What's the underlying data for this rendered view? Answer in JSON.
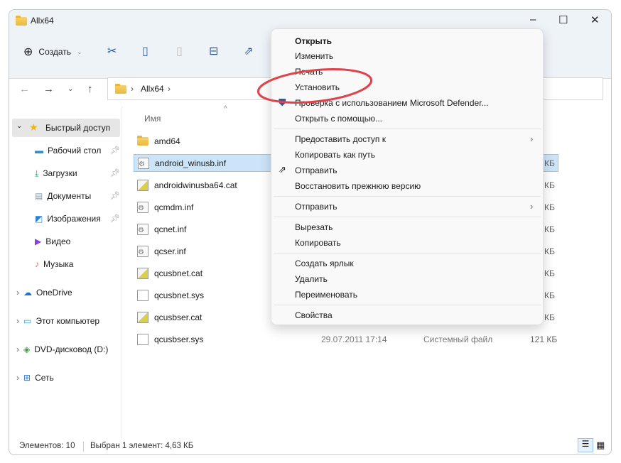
{
  "window": {
    "title": "Allx64"
  },
  "toolbar": {
    "create_label": "Создать"
  },
  "address": {
    "path": "Allx64"
  },
  "columns": {
    "name": "Имя"
  },
  "sidebar": {
    "quick_access": "Быстрый доступ",
    "items": [
      {
        "label": "Рабочий стол"
      },
      {
        "label": "Загрузки"
      },
      {
        "label": "Документы"
      },
      {
        "label": "Изображения"
      },
      {
        "label": "Видео"
      },
      {
        "label": "Музыка"
      }
    ],
    "roots": [
      {
        "label": "OneDrive"
      },
      {
        "label": "Этот компьютер"
      },
      {
        "label": "DVD-дисковод (D:)"
      },
      {
        "label": "Сеть"
      }
    ]
  },
  "files": [
    {
      "name": "amd64",
      "size": ""
    },
    {
      "name": "android_winusb.inf",
      "size": "КБ"
    },
    {
      "name": "androidwinusba64.cat",
      "size": "КБ"
    },
    {
      "name": "qcmdm.inf",
      "size": "КБ"
    },
    {
      "name": "qcnet.inf",
      "size": "КБ"
    },
    {
      "name": "qcser.inf",
      "size": "КБ"
    },
    {
      "name": "qcusbnet.cat",
      "size": "КБ"
    },
    {
      "name": "qcusbnet.sys",
      "size": "КБ"
    },
    {
      "name": "qcusbser.cat",
      "size": "КБ"
    },
    {
      "name": "qcusbser.sys",
      "date": "29.07.2011 17:14",
      "type": "Системный файл",
      "size": "121 КБ"
    }
  ],
  "menu": {
    "items": [
      "Открыть",
      "Изменить",
      "Печать",
      "Установить",
      "Проверка с использованием Microsoft Defender...",
      "Открыть с помощью...",
      "Предоставить доступ к",
      "Копировать как путь",
      "Отправить",
      "Восстановить прежнюю версию",
      "Отправить",
      "Вырезать",
      "Копировать",
      "Создать ярлык",
      "Удалить",
      "Переименовать",
      "Свойства"
    ]
  },
  "status": {
    "count": "Элементов: 10",
    "selected": "Выбран 1 элемент: 4,63 КБ"
  },
  "colors": {
    "accent": "#0067c0",
    "highlight": "#e0424a"
  }
}
